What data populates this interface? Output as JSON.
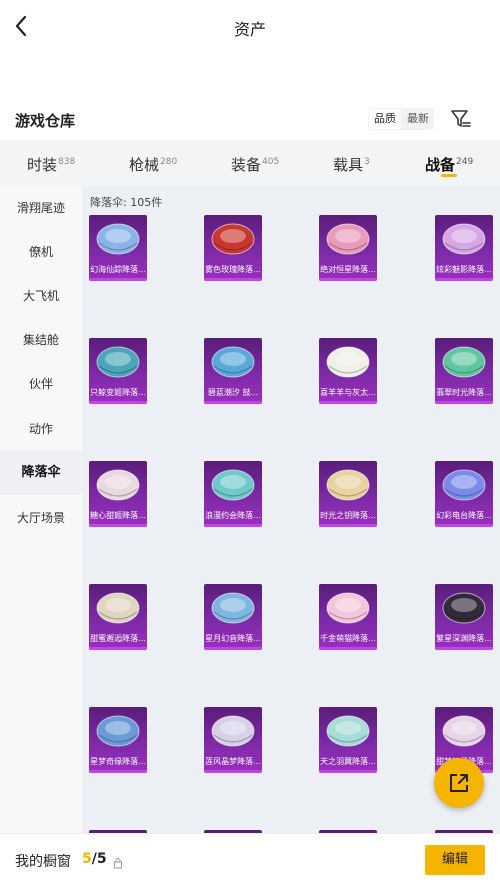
{
  "header": {
    "title": "资产",
    "back_icon": "chevron-left-icon"
  },
  "warehouse": {
    "title": "游戏仓库",
    "sort_options": [
      "品质",
      "最新"
    ],
    "active_sort": "品质",
    "filter_icon": "filter-icon"
  },
  "tabs": [
    {
      "label": "时装",
      "count": "838",
      "active": false
    },
    {
      "label": "枪械",
      "count": "280",
      "active": false
    },
    {
      "label": "装备",
      "count": "405",
      "active": false
    },
    {
      "label": "载具",
      "count": "3",
      "active": false
    },
    {
      "label": "战备",
      "count": "249",
      "active": true
    }
  ],
  "sidebar": {
    "items": [
      {
        "label": "滑翔尾迹",
        "active": false
      },
      {
        "label": "僚机",
        "active": false
      },
      {
        "label": "大飞机",
        "active": false
      },
      {
        "label": "集结舱",
        "active": false
      },
      {
        "label": "伙伴",
        "active": false
      },
      {
        "label": "动作",
        "active": false
      },
      {
        "label": "降落伞",
        "active": true
      },
      {
        "label": "大厅场景",
        "active": false
      }
    ]
  },
  "content": {
    "count_label": "降落伞: 105件",
    "items": [
      {
        "name": "幻海仙踪降落...",
        "color": "#8ab4e8"
      },
      {
        "name": "雾色玫瑰降落...",
        "color": "#c8372f"
      },
      {
        "name": "绝对恒星降落...",
        "color": "#e89ab8"
      },
      {
        "name": "炫彩魅影降落...",
        "color": "#d6a6e6"
      },
      {
        "name": "只鲸变姬降落...",
        "color": "#4aa6b8"
      },
      {
        "name": "碧蓝潮汐 鼓...",
        "color": "#5aa8d8"
      },
      {
        "name": "喜羊羊与灰太...",
        "color": "#f0f0e8"
      },
      {
        "name": "翡翠时光降落...",
        "color": "#5fc6a2"
      },
      {
        "name": "糖心甜姬降落...",
        "color": "#e8d8e0"
      },
      {
        "name": "浪漫约会降落...",
        "color": "#6fc9c9"
      },
      {
        "name": "时光之钥降落...",
        "color": "#e8d3a0"
      },
      {
        "name": "幻彩电台降落...",
        "color": "#7a8ae8"
      },
      {
        "name": "甜蜜邂逅降落...",
        "color": "#e0d6c0"
      },
      {
        "name": "星月幻音降落...",
        "color": "#7fb6e0"
      },
      {
        "name": "千金萌猫降落...",
        "color": "#f2c7dc"
      },
      {
        "name": "繁星深渊降落...",
        "color": "#332a3a"
      },
      {
        "name": "星梦奇缘降落...",
        "color": "#6a9ad8"
      },
      {
        "name": "莲风晶梦降落...",
        "color": "#d8d0e8"
      },
      {
        "name": "天之羽翼降落...",
        "color": "#a8dcd8"
      },
      {
        "name": "甜梦精灵降落...",
        "color": "#e8d4e8"
      }
    ]
  },
  "fab": {
    "icon": "share-export-icon",
    "color": "#f5b400"
  },
  "bottom": {
    "label": "我的橱窗",
    "current": "5",
    "total": "/5",
    "lock_icon": "lock-icon",
    "edit_label": "编辑"
  }
}
